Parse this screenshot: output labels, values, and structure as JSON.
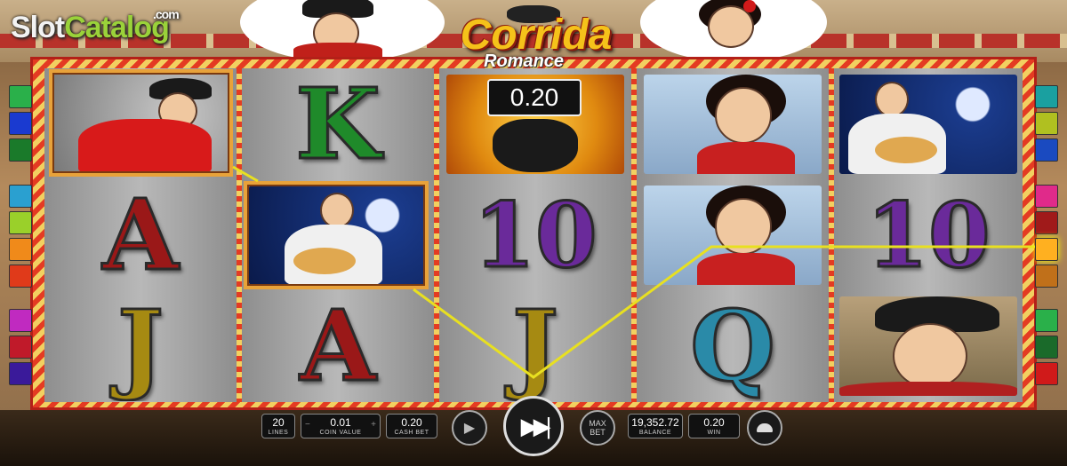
{
  "watermark": {
    "slot": "Slot",
    "catalog": "Catalog",
    "com": ".com"
  },
  "game": {
    "title_main": "Corrida",
    "title_sub": "Romance"
  },
  "win_amount": "0.20",
  "reels": [
    [
      "torero-symbol",
      "A",
      "J"
    ],
    [
      "K",
      "guitarist-symbol",
      "A"
    ],
    [
      "bull-symbol",
      "10",
      "J"
    ],
    [
      "senorita-symbol",
      "senorita-symbol",
      "Q"
    ],
    [
      "guitarist-symbol",
      "10",
      "matador-symbol"
    ]
  ],
  "controls": {
    "lines": {
      "value": "20",
      "label": "LINES"
    },
    "coin_value": {
      "value": "0.01",
      "label": "COIN VALUE"
    },
    "cash_bet": {
      "value": "0.20",
      "label": "CASH BET"
    },
    "max_bet": {
      "line1": "MAX",
      "line2": "BET"
    },
    "balance": {
      "value": "19,352.72",
      "label": "BALANCE"
    },
    "win": {
      "value": "0.20",
      "label": "WIN"
    }
  },
  "colors": {
    "payline": "#e8e020",
    "frame_red": "#e43b22",
    "frame_gold": "#f2d060"
  }
}
